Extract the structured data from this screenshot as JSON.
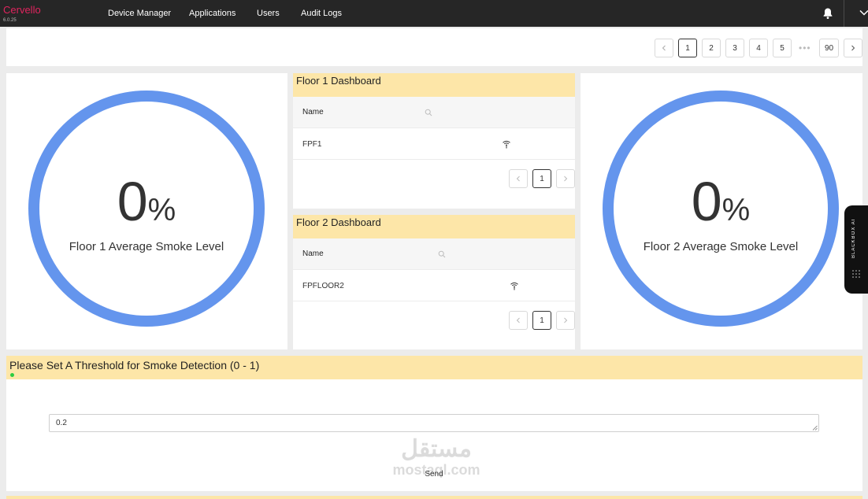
{
  "app": {
    "brand": "Cervello",
    "version": "6.0.25"
  },
  "nav": {
    "items": [
      "Device Manager",
      "Applications",
      "Users",
      "Audit Logs"
    ]
  },
  "pagination": {
    "pages": [
      "1",
      "2",
      "3",
      "4",
      "5"
    ],
    "ellipsis": "•••",
    "last": "90",
    "active": "1"
  },
  "gauge1": {
    "value": "0",
    "unit": "%",
    "label": "Floor 1 Average Smoke Level",
    "color": "#6495ed"
  },
  "gauge2": {
    "value": "0",
    "unit": "%",
    "label": "Floor 2 Average Smoke Level",
    "color": "#6495ed"
  },
  "floor1": {
    "title": "Floor 1 Dashboard",
    "column": "Name",
    "rows": [
      "FPF1"
    ],
    "page": "1"
  },
  "floor2": {
    "title": "Floor 2 Dashboard",
    "column": "Name",
    "rows": [
      "FPFLOOR2"
    ],
    "page": "1"
  },
  "threshold": {
    "title": "Please Set A Threshold for Smoke Detection (0 - 1)",
    "value": "0.2",
    "send_label": "Send"
  },
  "watermark": {
    "arabic": "مستقل",
    "latin": "mostaql.com"
  },
  "side_widget": {
    "label": "BLACKBOX AI"
  },
  "colors": {
    "accent": "#e0245e",
    "header_bg": "#fde6a8",
    "topbar": "#262626",
    "status": "#2ecc40"
  }
}
